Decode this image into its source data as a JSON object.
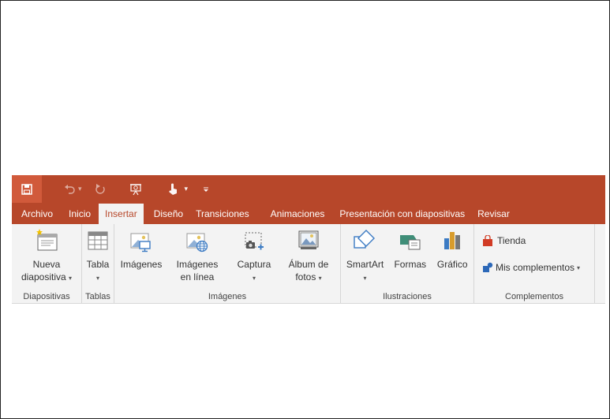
{
  "qat": {
    "save_icon": "save-icon",
    "undo_icon": "undo-icon",
    "redo_icon": "redo-icon",
    "present_icon": "present-from-beginning-icon",
    "touch_icon": "touch-mouse-mode-icon",
    "customize_icon": "customize-qat-icon"
  },
  "tabs": {
    "archivo": "Archivo",
    "inicio": "Inicio",
    "insertar": "Insertar",
    "diseno": "Diseño",
    "transiciones": "Transiciones",
    "animaciones": "Animaciones",
    "presentacion": "Presentación con diapositivas",
    "revisar": "Revisar"
  },
  "groups": {
    "diapositivas": {
      "label": "Diapositivas",
      "nueva_1": "Nueva",
      "nueva_2": "diapositiva"
    },
    "tablas": {
      "label": "Tablas",
      "tabla": "Tabla"
    },
    "imagenes": {
      "label": "Imágenes",
      "imagenes": "Imágenes",
      "en_linea_1": "Imágenes",
      "en_linea_2": "en línea",
      "captura": "Captura",
      "album_1": "Álbum de",
      "album_2": "fotos"
    },
    "ilustraciones": {
      "label": "Ilustraciones",
      "smartart": "SmartArt",
      "formas": "Formas",
      "grafico": "Gráfico"
    },
    "complementos": {
      "label": "Complementos",
      "tienda": "Tienda",
      "mis": "Mis complementos"
    }
  },
  "colors": {
    "accent": "#b7472a",
    "ribbon_bg": "#f3f3f3"
  }
}
